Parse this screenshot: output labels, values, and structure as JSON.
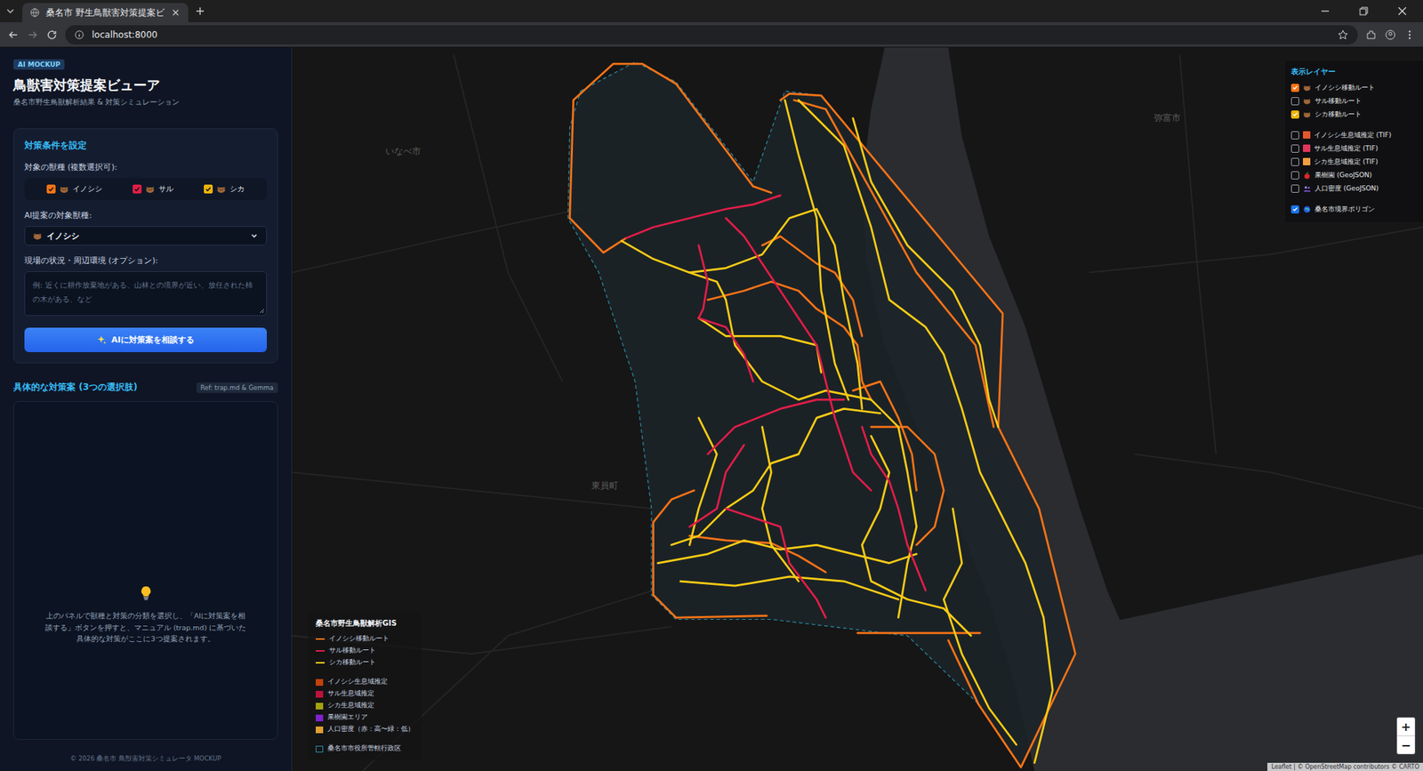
{
  "browser": {
    "tab_title": "桑名市 野生鳥獣害対策提案ビ",
    "address": "localhost:8000"
  },
  "sidebar": {
    "badge": "AI MOCKUP",
    "title": "鳥獣害対策提案ビューア",
    "subtitle": "桑名市野生鳥獣解析結果 & 対策シミュレーション",
    "settings": {
      "title": "対策条件を設定",
      "species_label": "対象の獣種 (複数選択可):",
      "species": [
        {
          "label": "イノシシ",
          "checked": true,
          "color": "#f97316"
        },
        {
          "label": "サル",
          "checked": true,
          "color": "#e11d48"
        },
        {
          "label": "シカ",
          "checked": true,
          "color": "#eab308"
        }
      ],
      "target_label": "AI提案の対象獣種:",
      "target_value": "イノシシ",
      "situation_label": "現場の状況・周辺環境 (オプション):",
      "situation_placeholder": "例: 近くに耕作放棄地がある、山林との境界が近い、放任された柿の木がある、など",
      "submit": "AIに対策案を相談する"
    },
    "results": {
      "title": "具体的な対策案 (3つの選択肢)",
      "tag": "Ref: trap.md & Gemma",
      "empty_text": "上のパネルで獣種と対策の分類を選択し、「AIに対策案を相談する」ボタンを押すと、マニュアル (trap.md) に基づいた具体的な対策がここに3つ提案されます。"
    },
    "footer": "© 2026 桑名市 鳥獣害対策シミュレータ MOCKUP"
  },
  "layers": {
    "title": "表示レイヤー",
    "items": [
      {
        "label": "イノシシ移動ルート",
        "kind": "route",
        "checked": true,
        "color": "#f97316"
      },
      {
        "label": "サル移動ルート",
        "kind": "route",
        "checked": false,
        "color": "#e11d48"
      },
      {
        "label": "シカ移動ルート",
        "kind": "route",
        "checked": true,
        "color": "#eab308"
      },
      {
        "label": "イノシシ生息域推定 (TIF)",
        "kind": "habitat",
        "checked": false,
        "color": "#e4572e"
      },
      {
        "label": "サル生息域推定 (TIF)",
        "kind": "habitat",
        "checked": false,
        "color": "#e0365c"
      },
      {
        "label": "シカ生息域推定 (TIF)",
        "kind": "habitat",
        "checked": false,
        "color": "#f59e42"
      },
      {
        "label": "果樹園 (GeoJSON)",
        "kind": "orchard",
        "checked": false
      },
      {
        "label": "人口密度 (GeoJSON)",
        "kind": "population",
        "checked": false
      },
      {
        "label": "桑名市境界ポリゴン",
        "kind": "boundary",
        "checked": true,
        "color": "#1a73e8"
      }
    ]
  },
  "legend": {
    "title": "桑名市野生鳥獣解析GIS",
    "lines": [
      {
        "label": "イノシシ移動ルート",
        "color": "#f97316"
      },
      {
        "label": "サル移動ルート",
        "color": "#e11d48"
      },
      {
        "label": "シカ移動ルート",
        "color": "#facc15"
      }
    ],
    "areas": [
      {
        "label": "イノシシ生息域推定",
        "color": "#c2410c"
      },
      {
        "label": "サル生息域推定",
        "color": "#be123c"
      },
      {
        "label": "シカ生息域推定",
        "color": "#a3a30f"
      },
      {
        "label": "果樹園エリア",
        "color": "#7e22ce"
      },
      {
        "label": "人口密度（赤：高〜緑：低）",
        "color": "#e0a030"
      }
    ],
    "district": {
      "label": "桑名市市役所管轄行政区",
      "color": "#2a8aa0"
    }
  },
  "map": {
    "place_labels": [
      "いなべ市",
      "東員町",
      "弥富市"
    ],
    "zoom": [
      "+",
      "−"
    ],
    "attribution": "Leaflet | © OpenStreetMap contributors © CARTO"
  }
}
